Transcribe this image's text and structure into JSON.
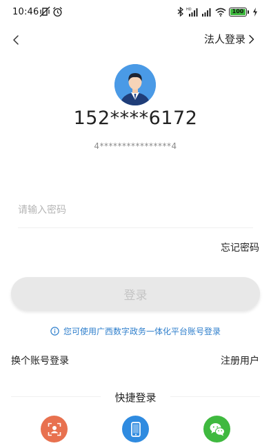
{
  "status_bar": {
    "time": "10:46",
    "battery": "100"
  },
  "nav": {
    "legal_login": "法人登录"
  },
  "account": {
    "phone": "152****6172",
    "id_number": "4****************4"
  },
  "password": {
    "placeholder": "请输入密码",
    "value": ""
  },
  "forgot_password": "忘记密码",
  "login_button": "登录",
  "notice": "您可使用广西数字政务一体化平台账号登录",
  "switch_account": "换个账号登录",
  "register": "注册用户",
  "quick_login": {
    "title": "快捷登录",
    "options": [
      {
        "icon": "face-recognition-icon",
        "color": "#e8714f"
      },
      {
        "icon": "mobile-phone-icon",
        "color": "#2f8be0"
      },
      {
        "icon": "wechat-icon",
        "color": "#3fb93f"
      }
    ]
  },
  "colors": {
    "accent": "#2f7fcc",
    "disabled_button": "#e8e8e8",
    "disabled_text": "#c4c4c4"
  }
}
